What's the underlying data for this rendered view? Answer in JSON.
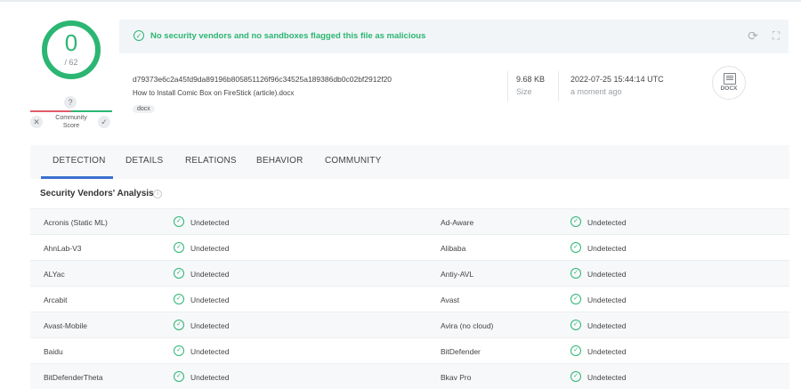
{
  "score": {
    "detected": "0",
    "total": "/ 62",
    "help": "?",
    "community_label": "Community Score",
    "negative_icon": "✕",
    "positive_icon": "✓"
  },
  "banner": {
    "message": "No security vendors and no sandboxes flagged this file as malicious",
    "status_color": "#2bb673",
    "check_icon": "✓",
    "refresh_icon": "⟳",
    "graph_icon": "⛶"
  },
  "file": {
    "hash": "d79373e6c2a45fd9da89196b805851126f96c34525a189386db0c02bf2912f20",
    "name": "How to Install Comic Box on FireStick (article).docx",
    "tag": "docx",
    "size_value": "9.68 KB",
    "size_label": "Size",
    "date_value": "2022-07-25 15:44:14 UTC",
    "date_label": "a moment ago",
    "type_badge": "DOCX"
  },
  "tabs": [
    {
      "label": "DETECTION"
    },
    {
      "label": "DETAILS"
    },
    {
      "label": "RELATIONS"
    },
    {
      "label": "BEHAVIOR"
    },
    {
      "label": "COMMUNITY"
    }
  ],
  "section": {
    "title": "Security Vendors' Analysis",
    "info_icon": "i"
  },
  "vendors": [
    {
      "left": "Acronis (Static ML)",
      "left_result": "Undetected",
      "right": "Ad-Aware",
      "right_result": "Undetected"
    },
    {
      "left": "AhnLab-V3",
      "left_result": "Undetected",
      "right": "Alibaba",
      "right_result": "Undetected"
    },
    {
      "left": "ALYac",
      "left_result": "Undetected",
      "right": "Antiy-AVL",
      "right_result": "Undetected"
    },
    {
      "left": "Arcabit",
      "left_result": "Undetected",
      "right": "Avast",
      "right_result": "Undetected"
    },
    {
      "left": "Avast-Mobile",
      "left_result": "Undetected",
      "right": "Avira (no cloud)",
      "right_result": "Undetected"
    },
    {
      "left": "Baidu",
      "left_result": "Undetected",
      "right": "BitDefender",
      "right_result": "Undetected"
    },
    {
      "left": "BitDefenderTheta",
      "left_result": "Undetected",
      "right": "Bkav Pro",
      "right_result": "Undetected"
    }
  ],
  "row_check_icon": "✓"
}
